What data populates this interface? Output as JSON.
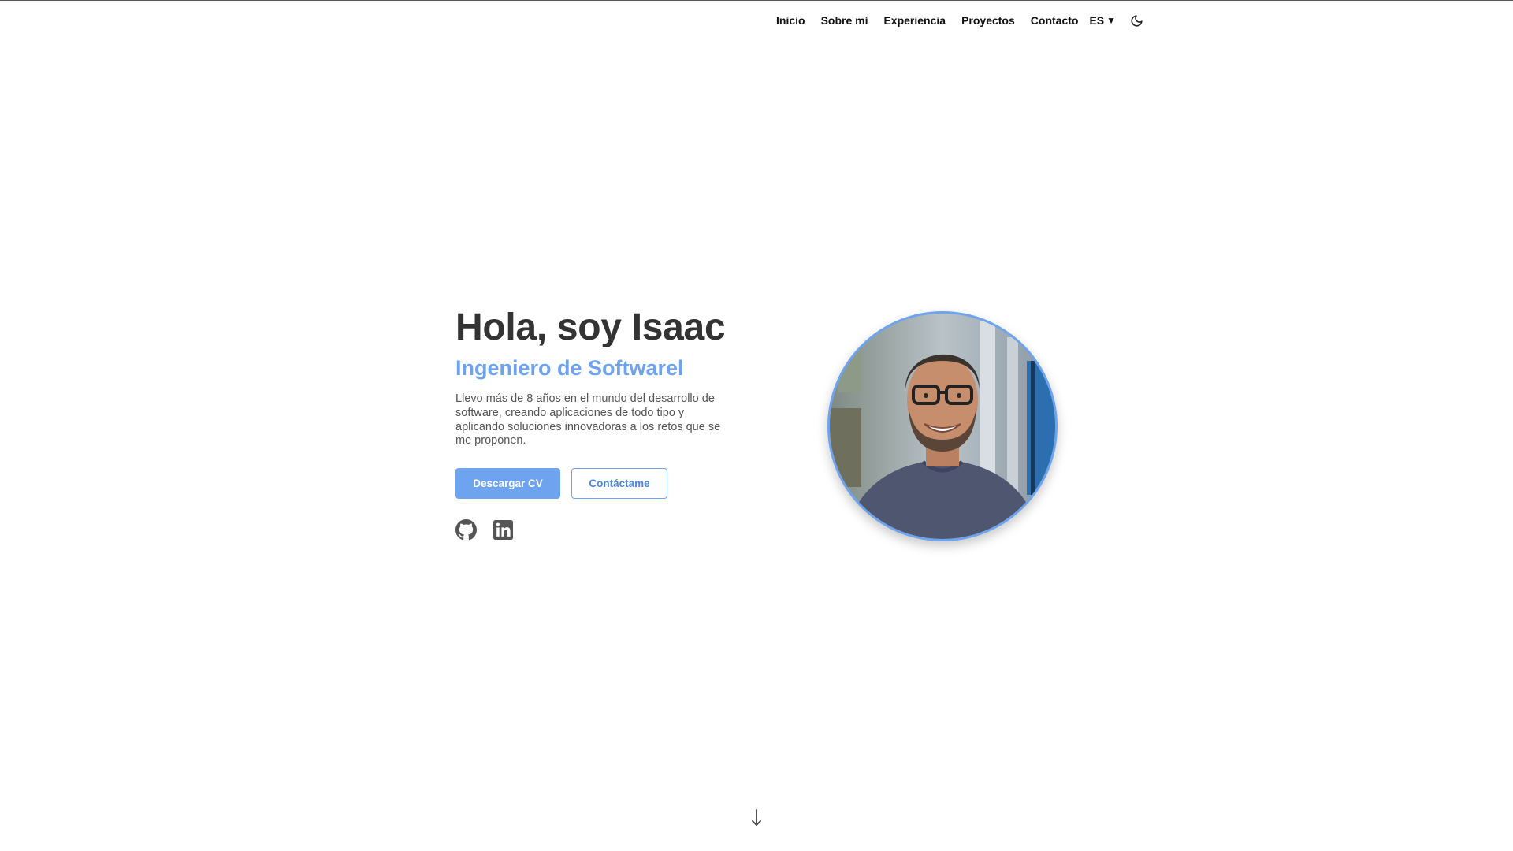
{
  "nav": {
    "links": [
      "Inicio",
      "Sobre mí",
      "Experiencia",
      "Proyectos",
      "Contacto"
    ],
    "language": "ES",
    "language_caret": "▼",
    "theme_icon": "moon-icon"
  },
  "hero": {
    "title": "Hola, soy Isaac",
    "subtitle": "Ingeniero de Softwarel",
    "description": "Llevo más de 8 años en el mundo del desarrollo de software, creando aplicaciones de todo tipo y aplicando soluciones innovadoras a los retos que se me proponen.",
    "buttons": {
      "download_cv": "Descargar CV",
      "contact": "Contáctame"
    },
    "social": [
      "github-icon",
      "linkedin-icon"
    ]
  },
  "profile": {
    "image": "profile-photo"
  },
  "scroll": {
    "icon": "arrow-down-icon"
  },
  "colors": {
    "accent": "#6ea3ef",
    "text_dark": "#333333",
    "text_muted": "#555555"
  }
}
